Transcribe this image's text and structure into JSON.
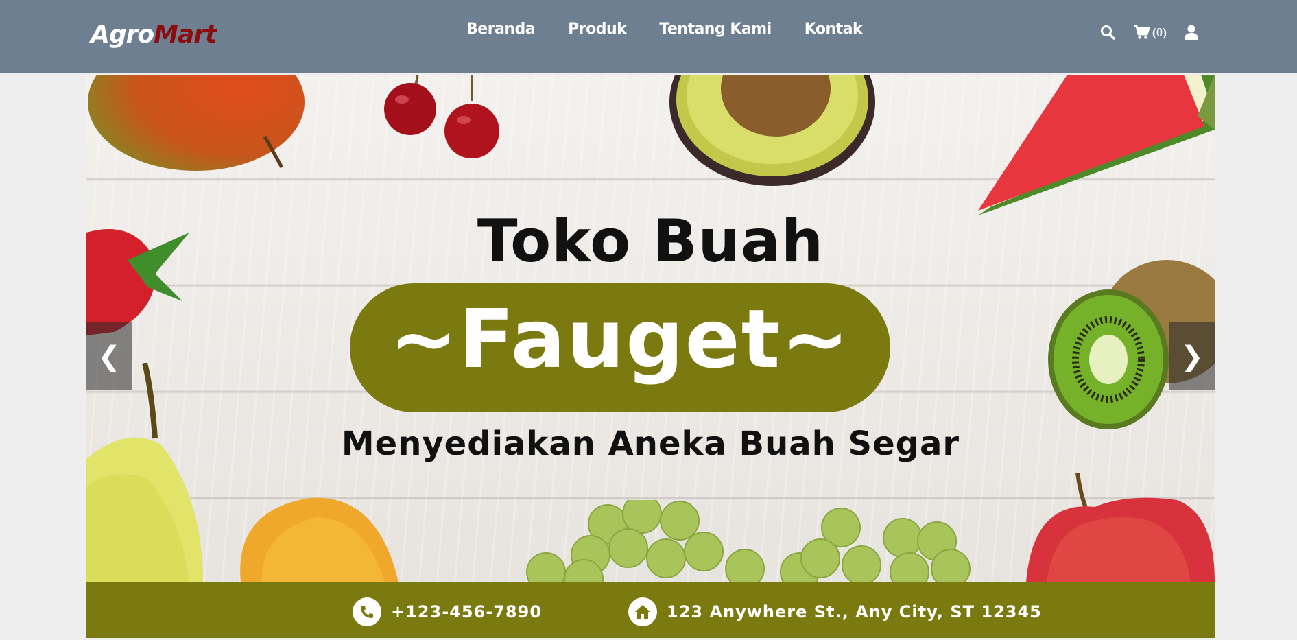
{
  "brand": {
    "part1": "Agro",
    "part2": "Mart"
  },
  "nav": {
    "links": [
      {
        "label": "Beranda"
      },
      {
        "label": "Produk"
      },
      {
        "label": "Tentang Kami"
      },
      {
        "label": "Kontak"
      }
    ],
    "cart_count": "(0)",
    "icons": [
      "search-icon",
      "cart-icon",
      "user-icon"
    ]
  },
  "hero": {
    "title": "Toko Buah",
    "highlight": "~Fauget~",
    "subtitle": "Menyediakan Aneka Buah Segar",
    "phone": "+123-456-7890",
    "address": "123 Anywhere St., Any City, ST 12345",
    "prev_label": "❮",
    "next_label": "❯"
  },
  "colors": {
    "navbar": "#6e7f91",
    "brand_accent": "#8b0c0c",
    "olive": "#7a7a10",
    "page_bg": "#eeeeee"
  }
}
